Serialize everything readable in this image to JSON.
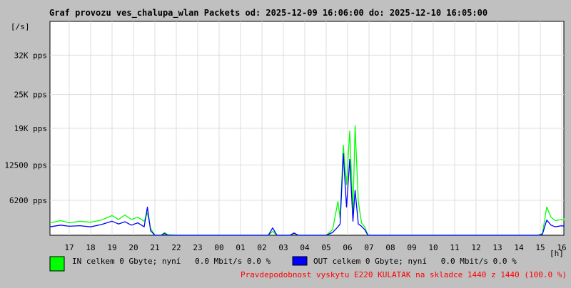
{
  "chart_data": {
    "type": "line",
    "title": "Graf provozu ves_chalupa_wlan Packets od: 2025-12-09 16:06:00 do: 2025-12-10 16:05:00",
    "ylabel": "[/s]",
    "xlabel": "[h]",
    "ylim": [
      0,
      38000
    ],
    "grid": true,
    "y_ticks": [
      {
        "value": 6200,
        "label": "6200 pps"
      },
      {
        "value": 12500,
        "label": "12500 pps"
      },
      {
        "value": 19000,
        "label": "19K pps"
      },
      {
        "value": 25000,
        "label": "25K pps"
      },
      {
        "value": 32000,
        "label": "32K pps"
      }
    ],
    "x_ticks": [
      "17",
      "18",
      "19",
      "20",
      "21",
      "22",
      "23",
      "00",
      "01",
      "02",
      "03",
      "04",
      "05",
      "06",
      "07",
      "08",
      "09",
      "10",
      "11",
      "12",
      "13",
      "14",
      "15",
      "16"
    ],
    "x_hours": [
      16.1,
      16.6,
      17.0,
      17.5,
      18.0,
      18.5,
      19.0,
      19.3,
      19.6,
      19.9,
      20.2,
      20.5,
      20.65,
      20.8,
      21.0,
      21.3,
      21.45,
      21.6,
      22.0,
      23.0,
      24.0,
      25.0,
      26.0,
      26.3,
      26.5,
      26.7,
      27.0,
      27.3,
      27.5,
      27.7,
      28.0,
      28.5,
      28.8,
      29.0,
      29.3,
      29.55,
      29.65,
      29.8,
      29.95,
      30.1,
      30.25,
      30.35,
      30.5,
      30.65,
      30.8,
      30.95,
      31.2,
      31.5,
      32.0,
      33.0,
      34.0,
      35.0,
      36.0,
      37.0,
      38.0,
      38.5,
      38.9,
      39.1,
      39.3,
      39.5,
      39.7,
      40.0,
      40.5,
      41.0
    ],
    "series": [
      {
        "name": "IN",
        "color": "#00ff00",
        "values": [
          2200,
          2600,
          2200,
          2500,
          2300,
          2700,
          3500,
          2800,
          3600,
          2800,
          3200,
          2500,
          4000,
          1200,
          0,
          0,
          500,
          100,
          0,
          0,
          0,
          0,
          0,
          0,
          700,
          0,
          0,
          0,
          300,
          0,
          0,
          0,
          0,
          0,
          1000,
          6000,
          3000,
          16000,
          9000,
          18500,
          4000,
          19500,
          6000,
          2200,
          1500,
          0,
          0,
          0,
          0,
          0,
          0,
          0,
          0,
          0,
          0,
          0,
          0,
          300,
          5000,
          3200,
          2600,
          2800,
          2700,
          3000
        ]
      },
      {
        "name": "OUT",
        "color": "#0000ff",
        "values": [
          1500,
          1800,
          1600,
          1700,
          1500,
          1900,
          2500,
          2000,
          2400,
          1800,
          2200,
          1500,
          5000,
          800,
          0,
          0,
          300,
          0,
          0,
          0,
          0,
          0,
          0,
          0,
          1300,
          0,
          0,
          0,
          400,
          0,
          0,
          0,
          0,
          0,
          500,
          1500,
          2000,
          14500,
          5000,
          13500,
          2500,
          8000,
          2000,
          1600,
          1000,
          0,
          0,
          0,
          0,
          0,
          0,
          0,
          0,
          0,
          0,
          0,
          0,
          200,
          2700,
          1800,
          1500,
          1700,
          1600,
          1800
        ]
      }
    ]
  },
  "legend": {
    "in_text": "IN celkem 0 Gbyte; nyní   0.0 Mbit/s 0.0 %",
    "out_text": "OUT celkem 0 Gbyte; nyní   0.0 Mbit/s 0.0 %"
  },
  "footer": {
    "warning": "Pravdepodobnost vyskytu E220 KULATAK na skladce 1440 z 1440 (100.0 %)"
  }
}
